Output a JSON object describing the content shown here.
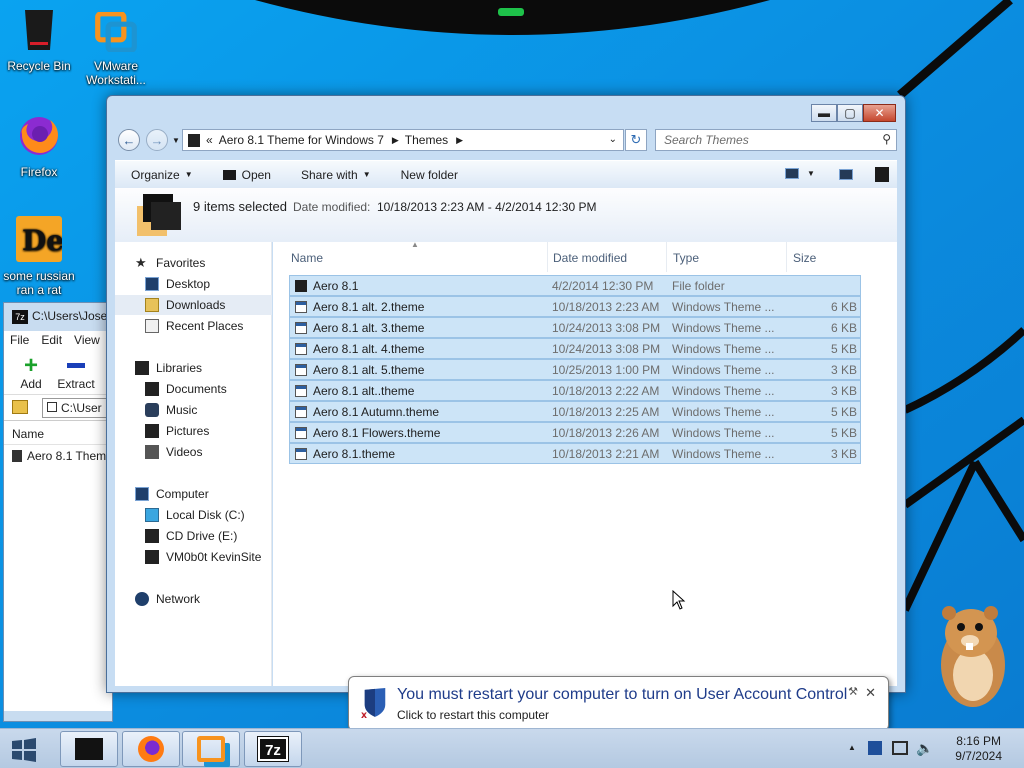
{
  "desktop": {
    "icons": [
      {
        "label_1": "Recycle Bin",
        "label_2": ""
      },
      {
        "label_1": "VMware",
        "label_2": "Workstati..."
      },
      {
        "label_1": "Firefox",
        "label_2": ""
      },
      {
        "label_1": "some russian",
        "label_2": "ran a rat"
      }
    ]
  },
  "zip_window": {
    "title": "C:\\Users\\Josep",
    "menu": [
      "File",
      "Edit",
      "View"
    ],
    "tools": [
      "Add",
      "Extract"
    ],
    "address": "C:\\User",
    "column": "Name",
    "row": "Aero 8.1 Them"
  },
  "explorer": {
    "address": {
      "overflow": "«",
      "crumbs": [
        "Aero 8.1 Theme for Windows 7",
        "Themes"
      ]
    },
    "search_placeholder": "Search Themes",
    "commands": {
      "organize": "Organize",
      "open": "Open",
      "share_with": "Share with",
      "new_folder": "New folder"
    },
    "details": {
      "selected": "9 items selected",
      "date_label": "Date modified:",
      "date_value": "10/18/2013 2:23 AM - 4/2/2014 12:30 PM"
    },
    "nav": {
      "favorites": "Favorites",
      "desktop": "Desktop",
      "downloads": "Downloads",
      "recent": "Recent Places",
      "libraries": "Libraries",
      "documents": "Documents",
      "music": "Music",
      "pictures": "Pictures",
      "videos": "Videos",
      "computer": "Computer",
      "local_disk": "Local Disk (C:)",
      "cd_drive": "CD Drive (E:)",
      "vm_share": "VM0b0t KevinSite",
      "network": "Network"
    },
    "columns": {
      "name": "Name",
      "date": "Date modified",
      "type": "Type",
      "size": "Size"
    },
    "files": [
      {
        "name": "Aero 8.1",
        "date": "4/2/2014 12:30 PM",
        "type": "File folder",
        "size": "",
        "kind": "folder"
      },
      {
        "name": "Aero 8.1 alt. 2.theme",
        "date": "10/18/2013 2:23 AM",
        "type": "Windows Theme ...",
        "size": "6 KB",
        "kind": "theme"
      },
      {
        "name": "Aero 8.1 alt. 3.theme",
        "date": "10/24/2013 3:08 PM",
        "type": "Windows Theme ...",
        "size": "6 KB",
        "kind": "theme"
      },
      {
        "name": "Aero 8.1 alt. 4.theme",
        "date": "10/24/2013 3:08 PM",
        "type": "Windows Theme ...",
        "size": "5 KB",
        "kind": "theme"
      },
      {
        "name": "Aero 8.1 alt. 5.theme",
        "date": "10/25/2013 1:00 PM",
        "type": "Windows Theme ...",
        "size": "3 KB",
        "kind": "theme"
      },
      {
        "name": "Aero 8.1 alt..theme",
        "date": "10/18/2013 2:22 AM",
        "type": "Windows Theme ...",
        "size": "3 KB",
        "kind": "theme"
      },
      {
        "name": "Aero 8.1 Autumn.theme",
        "date": "10/18/2013 2:25 AM",
        "type": "Windows Theme ...",
        "size": "5 KB",
        "kind": "theme"
      },
      {
        "name": "Aero 8.1 Flowers.theme",
        "date": "10/18/2013 2:26 AM",
        "type": "Windows Theme ...",
        "size": "5 KB",
        "kind": "theme"
      },
      {
        "name": "Aero 8.1.theme",
        "date": "10/18/2013 2:21 AM",
        "type": "Windows Theme ...",
        "size": "3 KB",
        "kind": "theme"
      }
    ]
  },
  "balloon": {
    "title": "You must restart your computer to turn on User Account Control",
    "subtitle": "Click to restart this computer"
  },
  "taskbar": {
    "zip_label": "7z",
    "time": "8:16 PM",
    "date": "9/7/2024"
  },
  "colors": {
    "selection_fill": "#cce4f7",
    "selection_border": "#9bc3e6",
    "balloon_title": "#1f3c8a"
  }
}
